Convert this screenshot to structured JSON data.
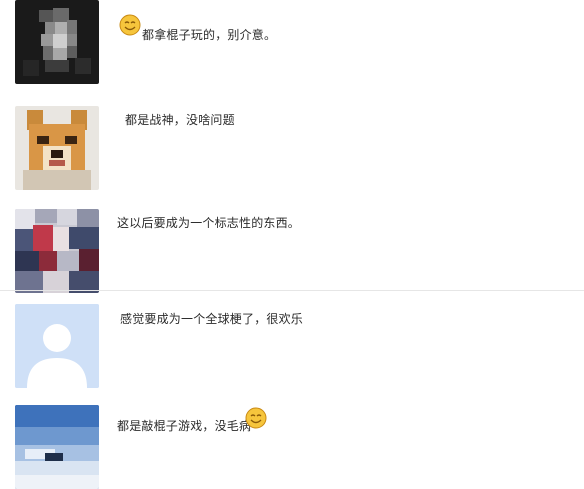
{
  "comments": [
    {
      "text": "都拿棍子玩的，别介意。",
      "avatar": "monkey-avatar",
      "emoji": "smile-emoji"
    },
    {
      "text": "都是战神，没啥问题",
      "avatar": "shiba-avatar"
    },
    {
      "text": "这以后要成为一个标志性的东西。",
      "avatar": "photo-avatar"
    },
    {
      "text": "感觉要成为一个全球梗了，很欢乐",
      "avatar": "default-user-avatar"
    },
    {
      "text": "都是敲棍子游戏，没毛病",
      "avatar": "sky-avatar",
      "emoji": "smile-emoji"
    }
  ],
  "colors": {
    "divider": "#e6e6e6",
    "emoji_face": "#f6c53c",
    "default_avatar_bg": "#cfe0f7"
  }
}
